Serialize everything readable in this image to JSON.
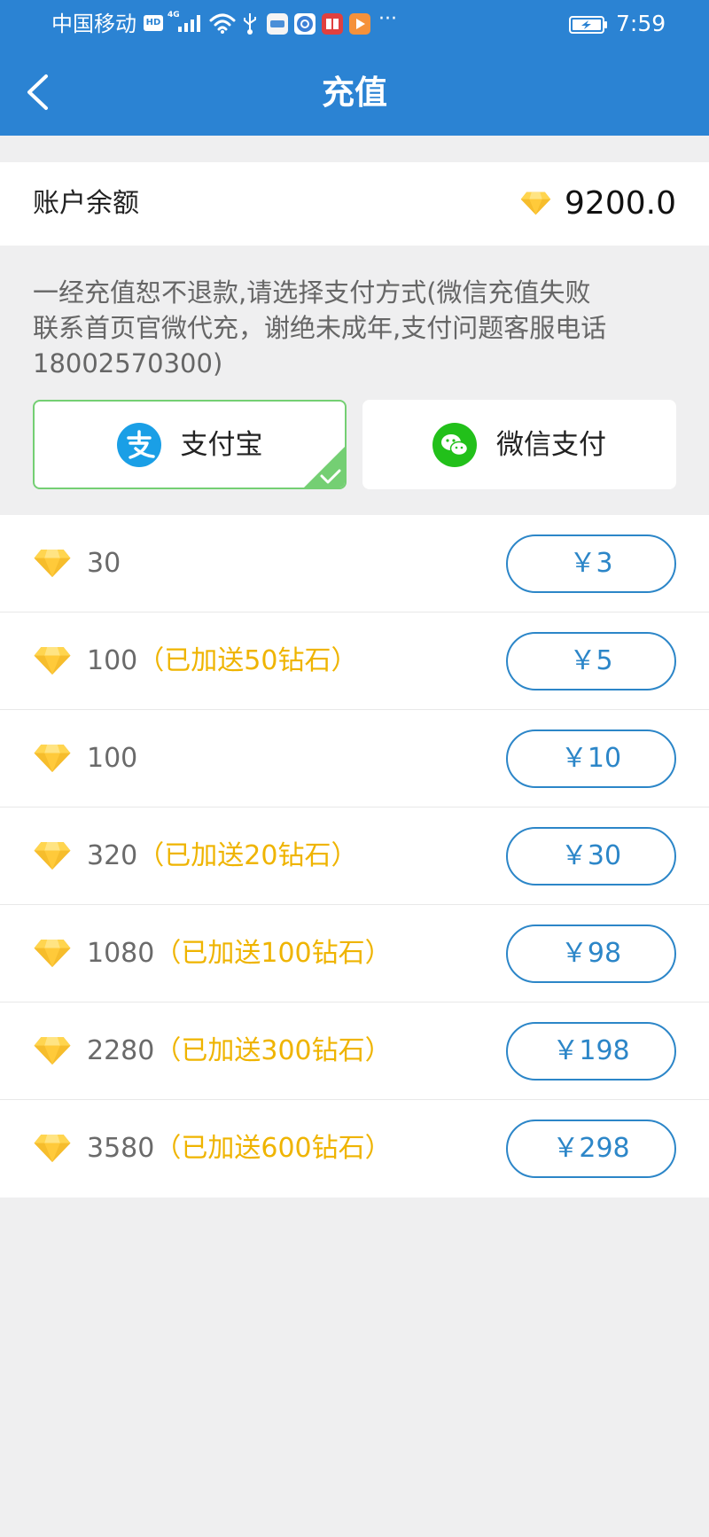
{
  "status_bar": {
    "carrier": "中国移动",
    "hd_badge": "HD",
    "network_type": "4G",
    "overflow": "···",
    "time": "7:59",
    "icons": [
      "signal-icon",
      "wifi-icon",
      "usb-icon",
      "gallery-notification-icon",
      "browser-notification-icon",
      "reader-notification-icon",
      "video-notification-icon",
      "battery-charging-icon"
    ]
  },
  "header": {
    "title": "充值",
    "back_icon": "chevron-left-icon"
  },
  "balance": {
    "label": "账户余额",
    "amount": "9200.0",
    "icon": "diamond-icon"
  },
  "notice": {
    "lines": [
      "一经充值恕不退款,请选择支付方式(微信充值失败",
      "联系首页官微代充，谢绝未成年,支付问题客服电话",
      "18002570300)"
    ]
  },
  "payment_methods": [
    {
      "label": "支付宝",
      "icon": "alipay-icon",
      "selected": true
    },
    {
      "label": "微信支付",
      "icon": "wechat-icon",
      "selected": false
    }
  ],
  "packages": [
    {
      "amount": "30",
      "price": "￥3"
    },
    {
      "amount": "100",
      "bonus": "（已加送50钻石）",
      "price": "￥5"
    },
    {
      "amount": "100",
      "price": "￥10"
    },
    {
      "amount": "320",
      "bonus": "（已加送20钻石）",
      "price": "￥30"
    },
    {
      "amount": "1080",
      "bonus": "（已加送100钻石）",
      "price": "￥98"
    },
    {
      "amount": "2280",
      "bonus": "（已加送300钻石）",
      "price": "￥198"
    },
    {
      "amount": "3580",
      "bonus": "（已加送600钻石）",
      "price": "￥298"
    }
  ],
  "colors": {
    "header": "#2b83d3",
    "bonus": "#efb400",
    "price": "#2c86c8",
    "selected": "#74cf73",
    "alipay": "#1a9fe6",
    "wechat": "#22c01a"
  }
}
